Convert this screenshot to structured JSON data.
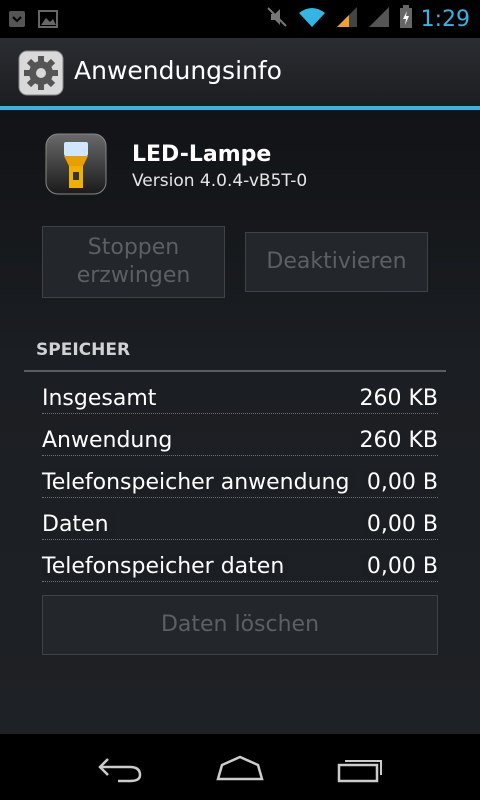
{
  "status_bar": {
    "time": "1:29",
    "accent": "#33b5e5",
    "icons": [
      "notification-icon",
      "image-icon",
      "muted-icon",
      "wifi-icon",
      "signal-icon",
      "signal-icon-2",
      "battery-charging-icon"
    ]
  },
  "action_bar": {
    "title": "Anwendungsinfo",
    "icon": "settings-gear-icon"
  },
  "app": {
    "name": "LED-Lampe",
    "version": "Version 4.0.4-vB5T-0",
    "icon": "flashlight-icon"
  },
  "buttons": {
    "force_stop": "Stoppen\nerzwingen",
    "deactivate": "Deaktivieren",
    "clear_data": "Daten löschen"
  },
  "storage": {
    "header": "SPEICHER",
    "rows": [
      {
        "label": "Insgesamt",
        "value": "260 KB"
      },
      {
        "label": "Anwendung",
        "value": "260 KB"
      },
      {
        "label": "Telefonspeicher anwendung",
        "value": "0,00 B"
      },
      {
        "label": "Daten",
        "value": "0,00 B"
      },
      {
        "label": "Telefonspeicher daten",
        "value": "0,00 B"
      }
    ]
  },
  "nav": {
    "icons": [
      "back-icon",
      "home-icon",
      "recent-apps-icon"
    ]
  }
}
